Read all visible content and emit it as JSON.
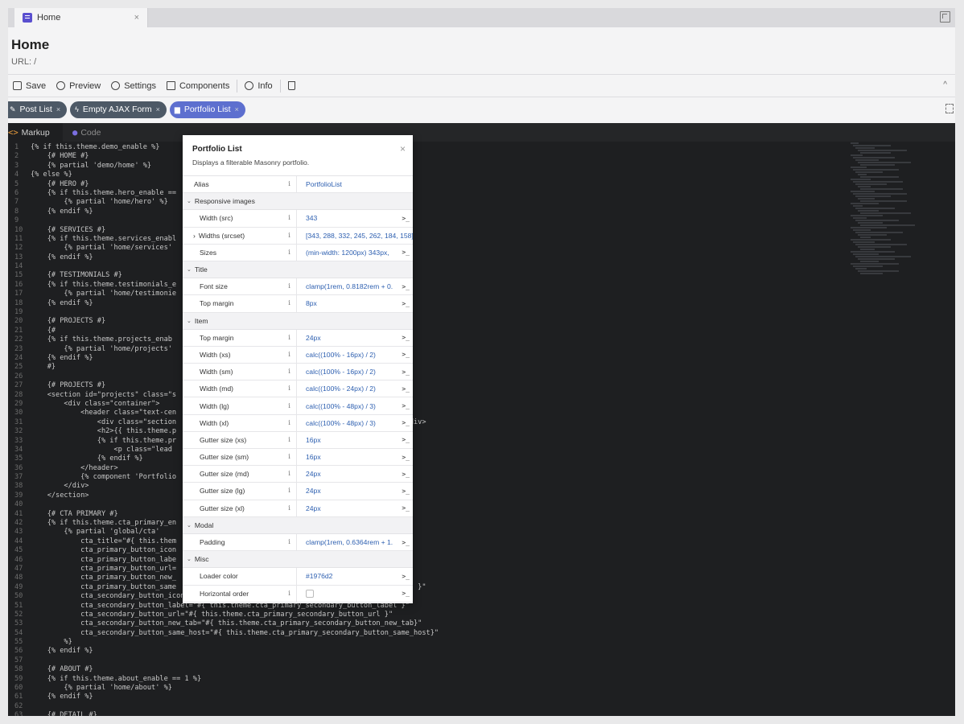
{
  "tab": {
    "label": "Home",
    "close": "×"
  },
  "header": {
    "title": "Home",
    "url": "URL: /"
  },
  "toolbar": {
    "save": "Save",
    "preview": "Preview",
    "settings": "Settings",
    "components": "Components",
    "info": "Info",
    "collapse": "^"
  },
  "chips": [
    {
      "icon": "✎",
      "label": "Post List",
      "close": "×"
    },
    {
      "icon": "ϟ",
      "label": "Empty AJAX Form",
      "close": "×"
    },
    {
      "icon": "▆",
      "label": "Portfolio List",
      "close": "×"
    }
  ],
  "editor": {
    "tab_markup": "Markup",
    "tab_code": "Code",
    "lines": [
      "{% if this.theme.demo_enable %}",
      "    {# HOME #}",
      "    {% partial 'demo/home' %}",
      "{% else %}",
      "    {# HERO #}",
      "    {% if this.theme.hero_enable ==",
      "        {% partial 'home/hero' %}",
      "    {% endif %}",
      "",
      "    {# SERVICES #}",
      "    {% if this.theme.services_enabl",
      "        {% partial 'home/services'",
      "    {% endif %}",
      "",
      "    {# TESTIMONIALS #}",
      "    {% if this.theme.testimonials_e",
      "        {% partial 'home/testimonie",
      "    {% endif %}",
      "",
      "    {# PROJECTS #}",
      "    {#",
      "    {% if this.theme.projects_enab",
      "        {% partial 'home/projects'",
      "    {% endif %}",
      "    #}",
      "",
      "    {# PROJECTS #}",
      "    <section id=\"projects\" class=\"s",
      "        <div class=\"container\">",
      "            <header class=\"text-cen",
      "                <div class=\"section                                                        div>",
      "                <h2>{{ this.theme.p",
      "                {% if this.theme.pr",
      "                    <p class=\"lead",
      "                {% endif %}",
      "            </header>",
      "            {% component 'Portfolio",
      "        </div>",
      "    </section>",
      "",
      "    {# CTA PRIMARY #}",
      "    {% if this.theme.cta_primary_en",
      "        {% partial 'global/cta'",
      "            cta_title=\"#{ this.them",
      "            cta_primary_button_icon",
      "            cta_primary_button_labe",
      "            cta_primary_button_url=",
      "            cta_primary_button_new_",
      "            cta_primary_button_same                                                          }\"",
      "            cta_secondary_button_icon=\"#{ this.theme.cta_primary_secondary_button_icon }\"",
      "            cta_secondary_button_label=\"#{ this.theme.cta_primary_secondary_button_label }\"",
      "            cta_secondary_button_url=\"#{ this.theme.cta_primary_secondary_button_url }\"",
      "            cta_secondary_button_new_tab=\"#{ this.theme.cta_primary_secondary_button_new_tab}\"",
      "            cta_secondary_button_same_host=\"#{ this.theme.cta_primary_secondary_button_same_host}\"",
      "        %}",
      "    {% endif %}",
      "",
      "    {# ABOUT #}",
      "    {% if this.theme.about_enable == 1 %}",
      "        {% partial 'home/about' %}",
      "    {% endif %}",
      "",
      "    {# DETAIL #}"
    ]
  },
  "inspector": {
    "title": "Portfolio List",
    "description": "Displays a filterable Masonry portfolio.",
    "close": "×",
    "info_glyph": "i",
    "arrow_glyph": ">_",
    "alias": {
      "label": "Alias",
      "value": "PortfolioList"
    },
    "groups": [
      {
        "name": "Responsive images",
        "rows": [
          {
            "label": "Width (src)",
            "value": "343",
            "arrow": true
          },
          {
            "label": "Widths (srcset)",
            "value": "[343, 288, 332, 245, 262, 184, 158]",
            "arrow": false,
            "expandable": true
          },
          {
            "label": "Sizes",
            "value": "(min-width: 1200px) 343px,",
            "arrow": true
          }
        ]
      },
      {
        "name": "Title",
        "rows": [
          {
            "label": "Font size",
            "value": "clamp(1rem, 0.8182rem + 0.",
            "arrow": true
          },
          {
            "label": "Top margin",
            "value": "8px",
            "arrow": true
          }
        ]
      },
      {
        "name": "Item",
        "rows": [
          {
            "label": "Top margin",
            "value": "24px",
            "arrow": true
          },
          {
            "label": "Width (xs)",
            "value": "calc((100% - 16px) / 2)",
            "arrow": true
          },
          {
            "label": "Width (sm)",
            "value": "calc((100% - 16px) / 2)",
            "arrow": true
          },
          {
            "label": "Width (md)",
            "value": "calc((100% - 24px) / 2)",
            "arrow": true
          },
          {
            "label": "Width (lg)",
            "value": "calc((100% - 48px) / 3)",
            "arrow": true
          },
          {
            "label": "Width (xl)",
            "value": "calc((100% - 48px) / 3)",
            "arrow": true
          },
          {
            "label": "Gutter size (xs)",
            "value": "16px",
            "arrow": true
          },
          {
            "label": "Gutter size (sm)",
            "value": "16px",
            "arrow": true
          },
          {
            "label": "Gutter size (md)",
            "value": "24px",
            "arrow": true
          },
          {
            "label": "Gutter size (lg)",
            "value": "24px",
            "arrow": true
          },
          {
            "label": "Gutter size (xl)",
            "value": "24px",
            "arrow": true
          }
        ]
      },
      {
        "name": "Modal",
        "rows": [
          {
            "label": "Padding",
            "value": "clamp(1rem, 0.6364rem + 1.",
            "arrow": true
          }
        ]
      },
      {
        "name": "Misc",
        "rows": [
          {
            "label": "Loader color",
            "value": "#1976d2",
            "arrow": true,
            "no_info": true
          },
          {
            "label": "Horizontal order",
            "value": "",
            "arrow": true,
            "checkbox": true
          }
        ]
      }
    ]
  },
  "colors": {
    "chip": "#4d5966",
    "chip_active": "#5d6fcf",
    "editor_bg": "#1e1f21",
    "value_link": "#2d5fb0"
  }
}
